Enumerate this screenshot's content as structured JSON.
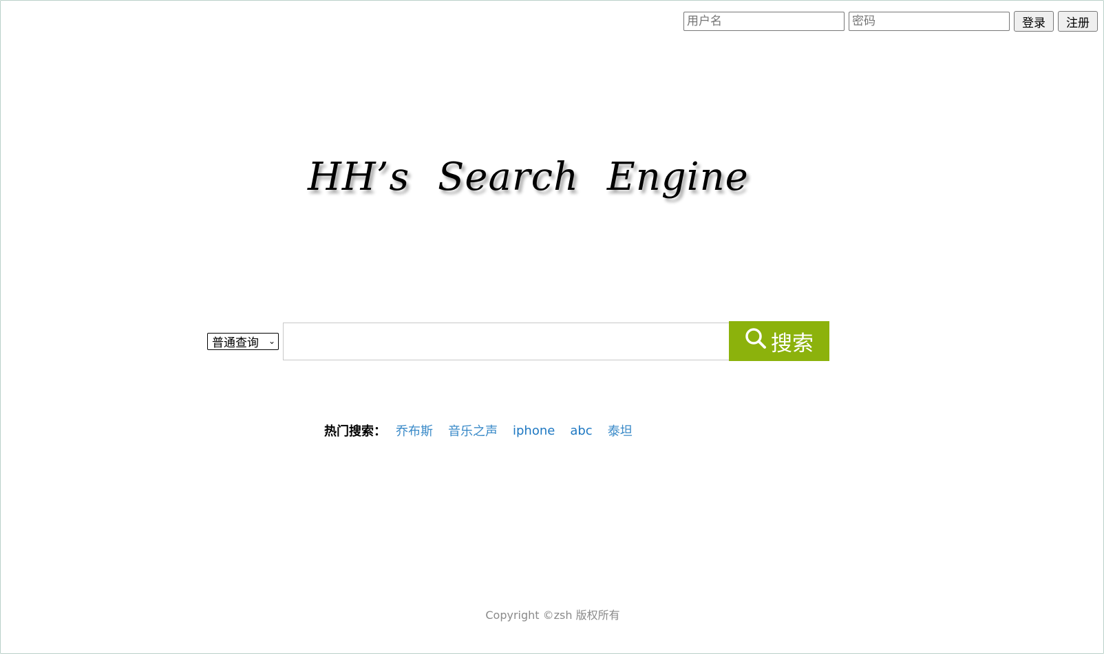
{
  "login": {
    "username_placeholder": "用户名",
    "password_placeholder": "密码",
    "login_label": "登录",
    "register_label": "注册"
  },
  "logo": {
    "text": "HH’s Search Engine"
  },
  "search": {
    "mode_selected": "普通查询",
    "input_value": "",
    "button_label": "搜索",
    "button_color": "#8cb20c"
  },
  "hot": {
    "label": "热门搜索：",
    "items": [
      "乔布斯",
      "音乐之声",
      "iphone",
      "abc",
      "泰坦"
    ],
    "link_color": "#1e78c2"
  },
  "footer": {
    "copyright": "Copyright ©zsh 版权所有"
  }
}
